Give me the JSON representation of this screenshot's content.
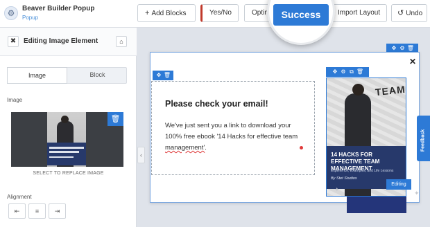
{
  "app": {
    "title": "Beaver Builder Popup",
    "subtitle": "Popup",
    "icon": "gear-icon"
  },
  "toolbar": {
    "add_blocks": "Add Blocks",
    "add_icon": "+",
    "yes_no": "Yes/No",
    "options": "Optin",
    "success": "Success",
    "import_layout": "Import Layout",
    "undo": "Undo",
    "undo_icon": "↺"
  },
  "panel": {
    "close_icon": "✖",
    "title": "Editing Image Element",
    "home_icon": "⌂",
    "tabs": [
      {
        "label": "Image",
        "active": true
      },
      {
        "label": "Block",
        "active": false
      }
    ],
    "image_label": "Image",
    "trash_icon": "🗑",
    "replace_label": "SELECT TO REPLACE IMAGE",
    "alignment_label": "Alignment",
    "align_icons": [
      "align-left-icon",
      "align-center-icon",
      "align-right-icon"
    ]
  },
  "popup": {
    "heading": "Please check your email!",
    "body_part1": "We've just sent you a link to download your 100% free ebook '14 Hacks for effective team ",
    "body_part2": "management'",
    "body_part3": ".",
    "close": "✕",
    "text_toolbar_icons": [
      "✥",
      "🗑"
    ],
    "image_toolbar_icons": [
      "✥",
      "⚙",
      "⧉",
      "🗑"
    ],
    "popup_toolbar_icons": [
      "✥",
      "⚙",
      "🗑"
    ],
    "editing_badge": "Editing"
  },
  "ebook": {
    "title": "14 HACKS FOR EFFECTIVE TEAM MANAGEMENT",
    "subtitle": "Experience, Examples, and Life Lessons",
    "author": "By Stet Studios",
    "art_text": "TEAM"
  },
  "feedback_label": "Feedback",
  "colors": {
    "accent": "#2d7ad6",
    "book": "#27396b",
    "yesno_marker": "#c0392b"
  }
}
